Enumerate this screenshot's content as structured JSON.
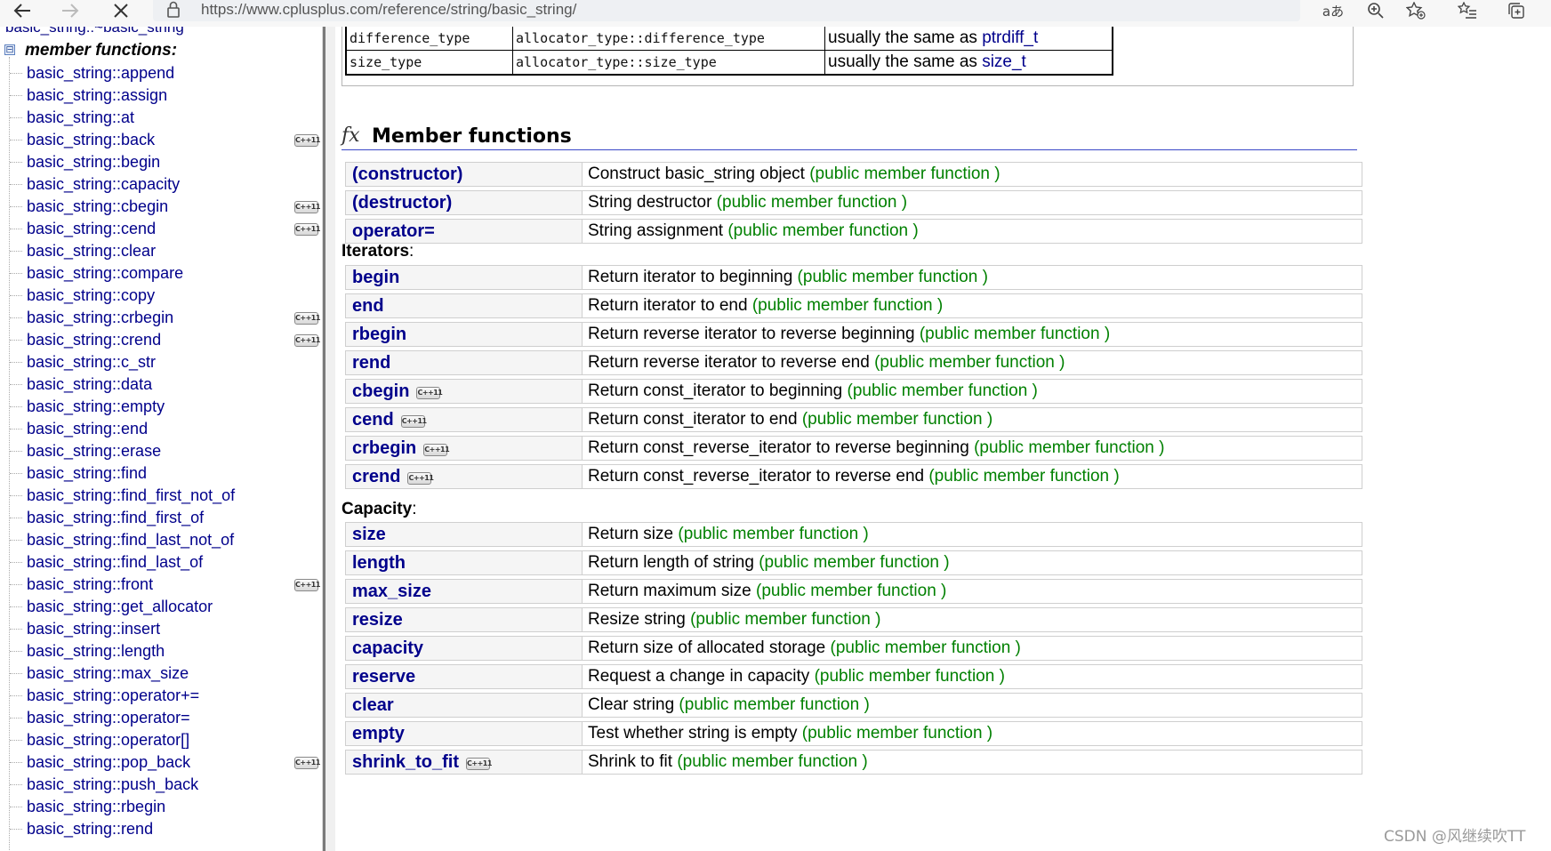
{
  "browser": {
    "url": "https://www.cplusplus.com/reference/string/basic_string/"
  },
  "sidebar": {
    "top_partial": "basic_string::~basic_string",
    "collapse_symbol": "⊟",
    "heading": "member functions:",
    "items": [
      {
        "label": "basic_string::append",
        "cpp11": false
      },
      {
        "label": "basic_string::assign",
        "cpp11": false
      },
      {
        "label": "basic_string::at",
        "cpp11": false
      },
      {
        "label": "basic_string::back",
        "cpp11": true
      },
      {
        "label": "basic_string::begin",
        "cpp11": false
      },
      {
        "label": "basic_string::capacity",
        "cpp11": false
      },
      {
        "label": "basic_string::cbegin",
        "cpp11": true
      },
      {
        "label": "basic_string::cend",
        "cpp11": true
      },
      {
        "label": "basic_string::clear",
        "cpp11": false
      },
      {
        "label": "basic_string::compare",
        "cpp11": false
      },
      {
        "label": "basic_string::copy",
        "cpp11": false
      },
      {
        "label": "basic_string::crbegin",
        "cpp11": true
      },
      {
        "label": "basic_string::crend",
        "cpp11": true
      },
      {
        "label": "basic_string::c_str",
        "cpp11": false
      },
      {
        "label": "basic_string::data",
        "cpp11": false
      },
      {
        "label": "basic_string::empty",
        "cpp11": false
      },
      {
        "label": "basic_string::end",
        "cpp11": false
      },
      {
        "label": "basic_string::erase",
        "cpp11": false
      },
      {
        "label": "basic_string::find",
        "cpp11": false
      },
      {
        "label": "basic_string::find_first_not_of",
        "cpp11": false
      },
      {
        "label": "basic_string::find_first_of",
        "cpp11": false
      },
      {
        "label": "basic_string::find_last_not_of",
        "cpp11": false
      },
      {
        "label": "basic_string::find_last_of",
        "cpp11": false
      },
      {
        "label": "basic_string::front",
        "cpp11": true
      },
      {
        "label": "basic_string::get_allocator",
        "cpp11": false
      },
      {
        "label": "basic_string::insert",
        "cpp11": false
      },
      {
        "label": "basic_string::length",
        "cpp11": false
      },
      {
        "label": "basic_string::max_size",
        "cpp11": false
      },
      {
        "label": "basic_string::operator+=",
        "cpp11": false
      },
      {
        "label": "basic_string::operator=",
        "cpp11": false
      },
      {
        "label": "basic_string::operator[]",
        "cpp11": false
      },
      {
        "label": "basic_string::pop_back",
        "cpp11": true
      },
      {
        "label": "basic_string::push_back",
        "cpp11": false
      },
      {
        "label": "basic_string::rbegin",
        "cpp11": false
      },
      {
        "label": "basic_string::rend",
        "cpp11": false
      }
    ]
  },
  "cpp11_badge": "C++11",
  "member_types_partial": [
    {
      "type": "difference_type",
      "definition": "allocator_type::difference_type",
      "notes_prefix": "usually the same as ",
      "notes_link": "ptrdiff_t"
    },
    {
      "type": "size_type",
      "definition": "allocator_type::size_type",
      "notes_prefix": "usually the same as ",
      "notes_link": "size_t"
    }
  ],
  "member_functions": {
    "icon": "fx",
    "title": "Member functions",
    "tag": "(public member function )",
    "general": [
      {
        "name": "(constructor)",
        "desc": "Construct basic_string object ",
        "cpp11": false
      },
      {
        "name": "(destructor)",
        "desc": "String destructor ",
        "cpp11": false
      },
      {
        "name": "operator=",
        "desc": "String assignment ",
        "cpp11": false
      }
    ],
    "iterators": {
      "heading": "Iterators",
      "items": [
        {
          "name": "begin",
          "desc": "Return iterator to beginning ",
          "cpp11": false
        },
        {
          "name": "end",
          "desc": "Return iterator to end ",
          "cpp11": false
        },
        {
          "name": "rbegin",
          "desc": "Return reverse iterator to reverse beginning ",
          "cpp11": false
        },
        {
          "name": "rend",
          "desc": "Return reverse iterator to reverse end ",
          "cpp11": false
        },
        {
          "name": "cbegin",
          "desc": "Return const_iterator to beginning ",
          "cpp11": true
        },
        {
          "name": "cend",
          "desc": "Return const_iterator to end ",
          "cpp11": true
        },
        {
          "name": "crbegin",
          "desc": "Return const_reverse_iterator to reverse beginning ",
          "cpp11": true
        },
        {
          "name": "crend",
          "desc": "Return const_reverse_iterator to reverse end ",
          "cpp11": true
        }
      ]
    },
    "capacity": {
      "heading": "Capacity",
      "items": [
        {
          "name": "size",
          "desc": "Return size ",
          "cpp11": false
        },
        {
          "name": "length",
          "desc": "Return length of string ",
          "cpp11": false
        },
        {
          "name": "max_size",
          "desc": "Return maximum size ",
          "cpp11": false
        },
        {
          "name": "resize",
          "desc": "Resize string ",
          "cpp11": false
        },
        {
          "name": "capacity",
          "desc": "Return size of allocated storage ",
          "cpp11": false
        },
        {
          "name": "reserve",
          "desc": "Request a change in capacity ",
          "cpp11": false
        },
        {
          "name": "clear",
          "desc": "Clear string ",
          "cpp11": false
        },
        {
          "name": "empty",
          "desc": "Test whether string is empty ",
          "cpp11": false
        },
        {
          "name": "shrink_to_fit",
          "desc": "Shrink to fit ",
          "cpp11": true
        }
      ]
    }
  },
  "watermark": "CSDN @风继续吹TT"
}
